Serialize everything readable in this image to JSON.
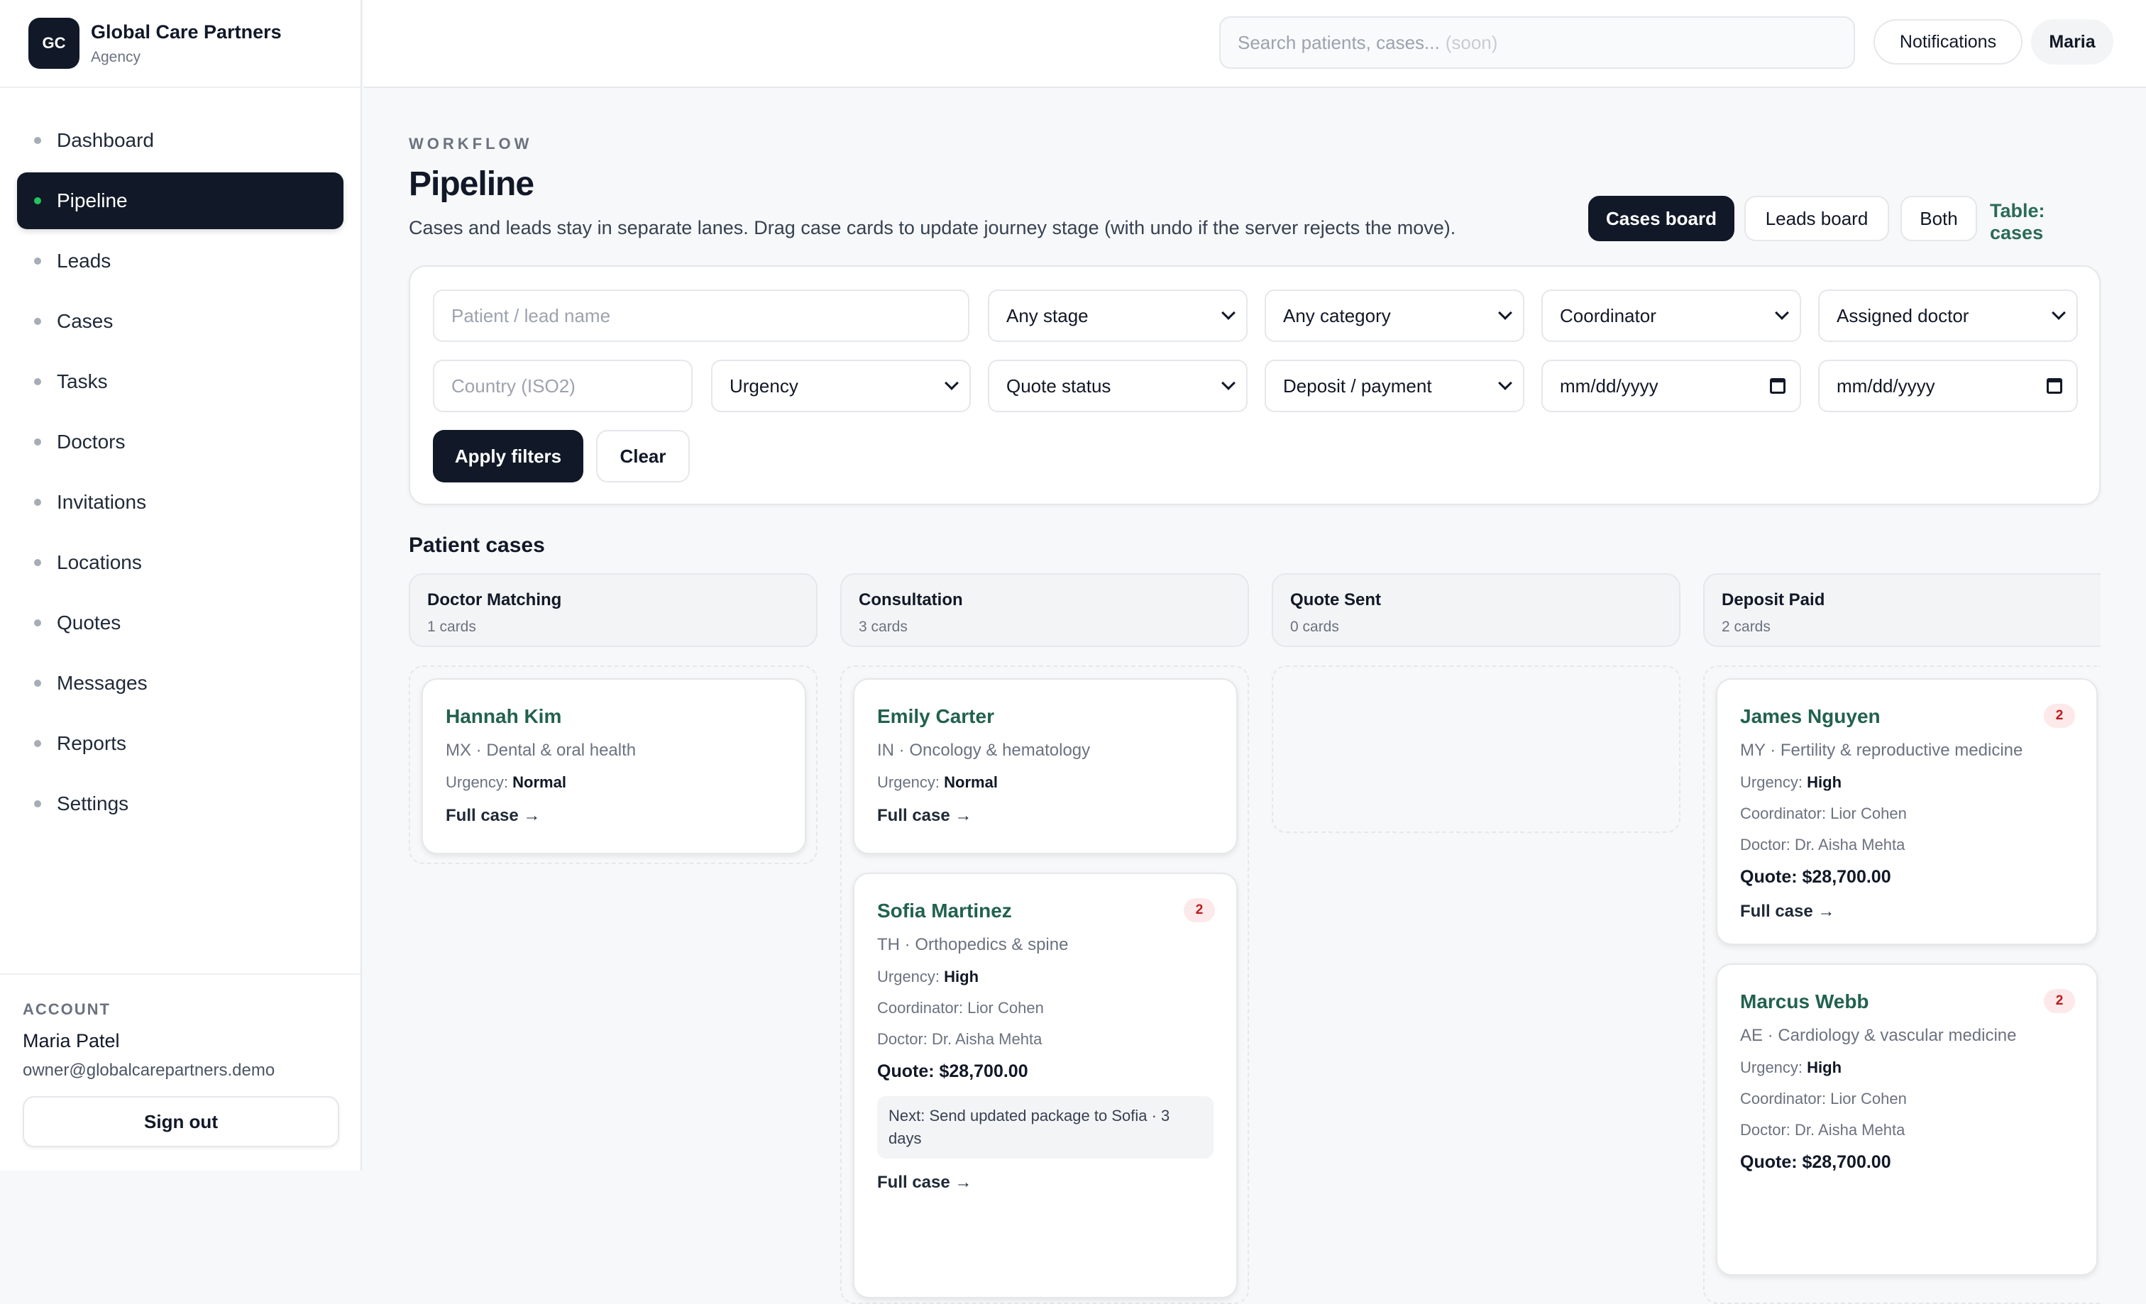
{
  "brand": {
    "logo": "GC",
    "name": "Global Care Partners",
    "subtitle": "Agency"
  },
  "sidebar": {
    "items": [
      {
        "label": "Dashboard",
        "active": false
      },
      {
        "label": "Pipeline",
        "active": true
      },
      {
        "label": "Leads",
        "active": false
      },
      {
        "label": "Cases",
        "active": false
      },
      {
        "label": "Tasks",
        "active": false
      },
      {
        "label": "Doctors",
        "active": false
      },
      {
        "label": "Invitations",
        "active": false
      },
      {
        "label": "Locations",
        "active": false
      },
      {
        "label": "Quotes",
        "active": false
      },
      {
        "label": "Messages",
        "active": false
      },
      {
        "label": "Reports",
        "active": false
      },
      {
        "label": "Settings",
        "active": false
      }
    ]
  },
  "account": {
    "label": "ACCOUNT",
    "name": "Maria Patel",
    "email": "owner@globalcarepartners.demo",
    "signout": "Sign out"
  },
  "topbar": {
    "search_placeholder": "Search patients, cases...",
    "search_soon": "(soon)",
    "notifications": "Notifications",
    "user": "Maria"
  },
  "header": {
    "eyebrow": "WORKFLOW",
    "title": "Pipeline",
    "description": "Cases and leads stay in separate lanes. Drag case cards to update journey stage (with undo if the server rejects the move).",
    "views": [
      "Cases board",
      "Leads board",
      "Both"
    ],
    "table_label": "Table: cases"
  },
  "filters": {
    "name_placeholder": "Patient / lead name",
    "stage": "Any stage",
    "category": "Any category",
    "coordinator": "Coordinator",
    "doctor": "Assigned doctor",
    "country_placeholder": "Country (ISO2)",
    "urgency": "Urgency",
    "quote_status": "Quote status",
    "deposit": "Deposit / payment",
    "date_from": "mm/dd/yyyy",
    "date_to": "mm/dd/yyyy",
    "apply": "Apply filters",
    "clear": "Clear"
  },
  "board": {
    "section_title": "Patient cases",
    "lanes": [
      {
        "name": "Doctor Matching",
        "count": "1 cards"
      },
      {
        "name": "Consultation",
        "count": "3 cards"
      },
      {
        "name": "Quote Sent",
        "count": "0 cards"
      },
      {
        "name": "Deposit Paid",
        "count": "2 cards"
      }
    ],
    "cards": {
      "hannah": {
        "name": "Hannah Kim",
        "meta": "MX · Dental & oral health",
        "urgency_label": "Urgency:",
        "urgency": "Normal",
        "link": "Full case →"
      },
      "emily": {
        "name": "Emily Carter",
        "meta": "IN · Oncology & hematology",
        "urgency_label": "Urgency:",
        "urgency": "Normal",
        "link": "Full case →"
      },
      "sofia": {
        "name": "Sofia Martinez",
        "badge": "2",
        "meta": "TH · Orthopedics & spine",
        "urgency_label": "Urgency:",
        "urgency": "High",
        "coordinator": "Coordinator: Lior Cohen",
        "doctor": "Doctor: Dr. Aisha Mehta",
        "quote": "Quote: $28,700.00",
        "next": "Next: Send updated package to Sofia · 3 days",
        "link": "Full case →"
      },
      "james": {
        "name": "James Nguyen",
        "badge": "2",
        "meta": "MY · Fertility & reproductive medicine",
        "urgency_label": "Urgency:",
        "urgency": "High",
        "coordinator": "Coordinator: Lior Cohen",
        "doctor": "Doctor: Dr. Aisha Mehta",
        "quote": "Quote: $28,700.00",
        "link": "Full case →"
      },
      "marcus": {
        "name": "Marcus Webb",
        "badge": "2",
        "meta": "AE · Cardiology & vascular medicine",
        "urgency_label": "Urgency:",
        "urgency": "High",
        "coordinator": "Coordinator: Lior Cohen",
        "doctor": "Doctor: Dr. Aisha Mehta",
        "quote": "Quote: $28,700.00"
      }
    }
  }
}
